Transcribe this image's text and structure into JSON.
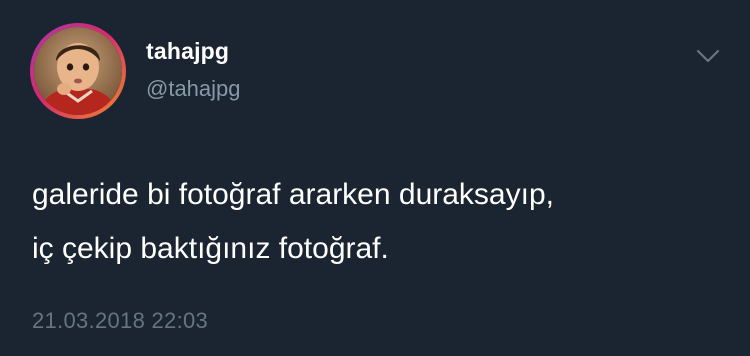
{
  "user": {
    "display_name": "tahajpg",
    "handle": "@tahajpg",
    "avatar_icon": "child-portrait-avatar"
  },
  "menu": {
    "icon": "chevron-down-icon"
  },
  "tweet": {
    "lines": [
      "galeride bi fotoğraf ararken duraksayıp,",
      "iç çekip baktığınız fotoğraf."
    ],
    "timestamp": "21.03.2018 22:03"
  },
  "colors": {
    "background": "#1b2431",
    "text": "#ffffff",
    "secondary_text": "#8899a6",
    "timestamp_text": "#66757f"
  }
}
